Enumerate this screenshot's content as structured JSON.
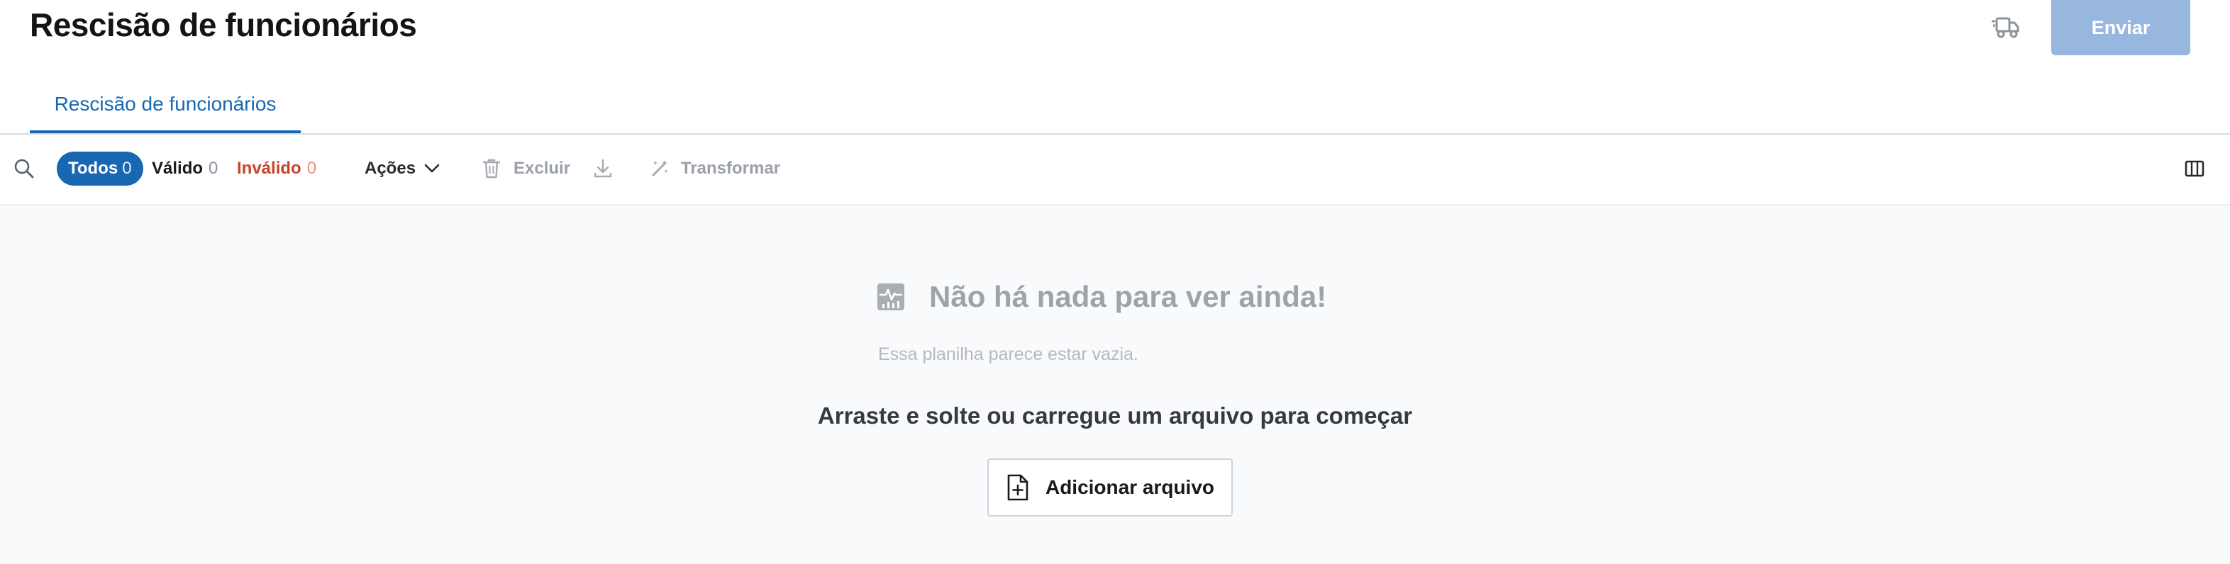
{
  "header": {
    "title": "Rescisão de funcionários",
    "submit_label": "Enviar",
    "truck_icon": "truck-icon"
  },
  "tabs": [
    {
      "label": "Rescisão de funcionários",
      "active": true
    }
  ],
  "toolbar": {
    "search_icon": "search-icon",
    "filters": {
      "all": {
        "label": "Todos",
        "count": "0"
      },
      "valid": {
        "label": "Válido",
        "count": "0"
      },
      "invalid": {
        "label": "Inválido",
        "count": "0"
      }
    },
    "actions_label": "Ações",
    "delete_label": "Excluir",
    "transform_label": "Transformar",
    "columns_icon": "columns-icon"
  },
  "empty_state": {
    "title": "Não há nada para ver ainda!",
    "subtitle": "Essa planilha parece estar vazia.",
    "drop_text": "Arraste e solte ou carregue um arquivo para começar",
    "add_file_label": "Adicionar arquivo"
  },
  "colors": {
    "primary": "#1767b2",
    "submit_disabled": "#98b7df",
    "invalid": "#c8432a",
    "empty_bg": "#f9fafc"
  }
}
